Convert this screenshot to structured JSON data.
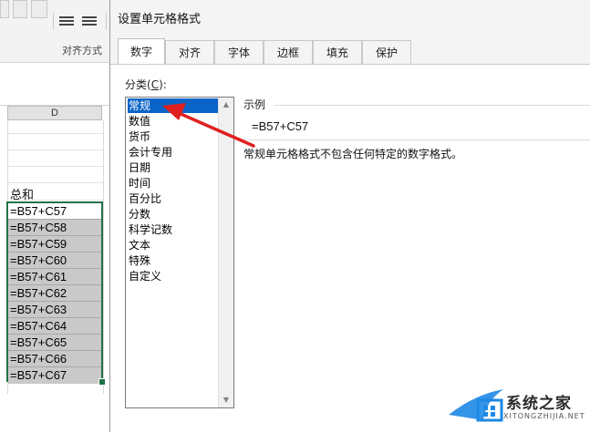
{
  "excel": {
    "ribbon_group": "对齐方式",
    "column_header": "D",
    "total_label": "总和",
    "cells": [
      "=B57+C57",
      "=B57+C58",
      "=B57+C59",
      "=B57+C60",
      "=B57+C61",
      "=B57+C62",
      "=B57+C63",
      "=B57+C64",
      "=B57+C65",
      "=B57+C66",
      "=B57+C67"
    ]
  },
  "dialog": {
    "title": "设置单元格格式",
    "tabs": [
      "数字",
      "对齐",
      "字体",
      "边框",
      "填充",
      "保护"
    ],
    "active_tab": "数字",
    "category_label_pre": "分类(",
    "category_label_key": "C",
    "category_label_post": "):",
    "categories": [
      "常规",
      "数值",
      "货币",
      "会计专用",
      "日期",
      "时间",
      "百分比",
      "分数",
      "科学记数",
      "文本",
      "特殊",
      "自定义"
    ],
    "selected_category": "常规",
    "example_label": "示例",
    "example_value": "=B57+C57",
    "description": "常规单元格格式不包含任何特定的数字格式。"
  },
  "colors": {
    "selection_border": "#217346",
    "selected_item": "#0a64c8",
    "annotation_arrow": "#e02020"
  },
  "watermark": {
    "text": "系统之家",
    "url": "XITONGZHIJIA.NET"
  }
}
